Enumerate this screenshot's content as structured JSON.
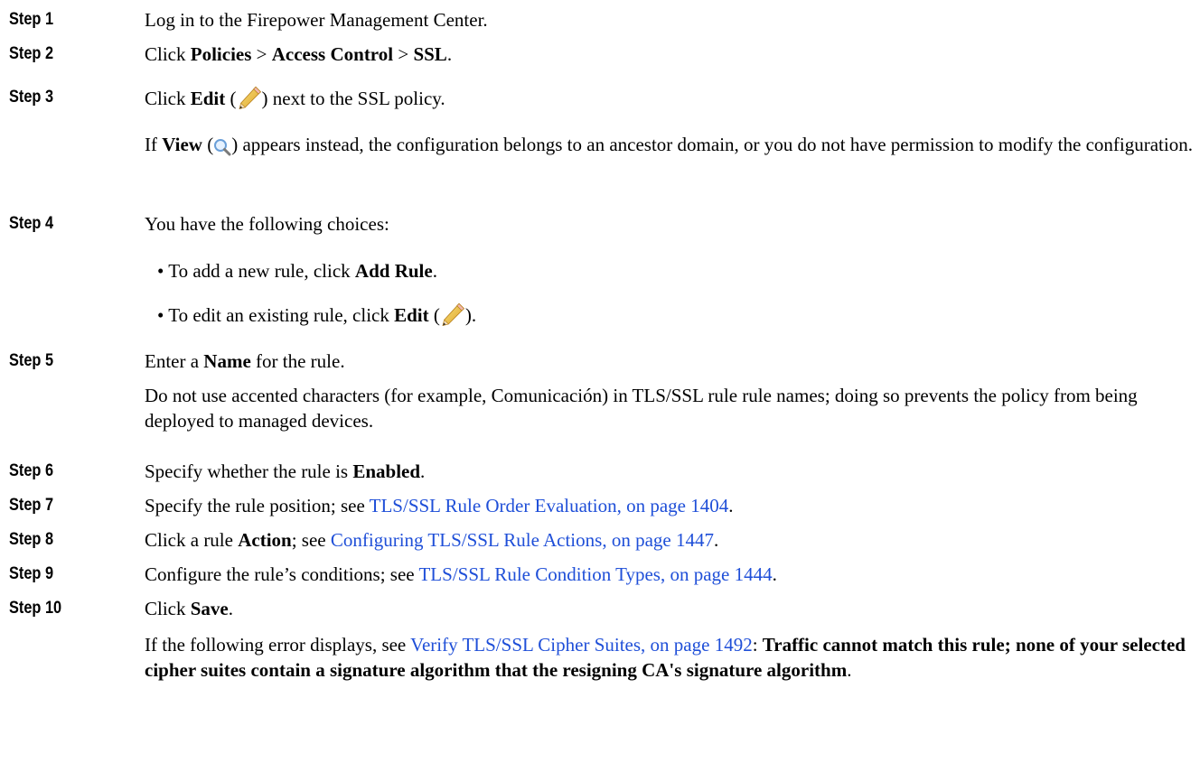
{
  "steps": {
    "s1": {
      "label": "Step 1",
      "text": "Log in to the Firepower Management Center."
    },
    "s2": {
      "label": "Step 2",
      "pre": "Click ",
      "b1": "Policies",
      "sep1": " > ",
      "b2": "Access Control",
      "sep2": " > ",
      "b3": "SSL",
      "post": "."
    },
    "s3": {
      "label": "Step 3",
      "pre": "Click ",
      "b1": "Edit",
      "open": " (",
      "close": ") next to the SSL policy.",
      "note_b": "View",
      "note_open": " (",
      "note_rest": ") appears instead, the configuration belongs to an ancestor domain, or you do not have permission to modify the configuration.",
      "note_if": "If "
    },
    "s4": {
      "label": "Step 4",
      "text": "You have the following choices:",
      "b1_pre": "• To add a new rule, click ",
      "b1_b": "Add Rule",
      "b1_post": ".",
      "b2_pre": "• To edit an existing rule, click ",
      "b2_b": "Edit",
      "b2_open": " (",
      "b2_close": ")."
    },
    "s5": {
      "label": "Step 5",
      "pre": "Enter a ",
      "b": "Name",
      "post": " for the rule.",
      "note": "Do not use accented characters (for example, Comunicación) in TLS/SSL rule rule names; doing so prevents the policy from being deployed to managed devices."
    },
    "s6": {
      "label": "Step 6",
      "pre": "Specify whether the rule is ",
      "b": "Enabled",
      "post": "."
    },
    "s7": {
      "label": "Step 7",
      "pre": "Specify the rule position; see ",
      "link": "TLS/SSL Rule Order Evaluation, on page 1404",
      "post": "."
    },
    "s8": {
      "label": "Step 8",
      "pre": "Click a rule ",
      "b": "Action",
      "mid": "; see ",
      "link": "Configuring TLS/SSL Rule Actions, on page 1447",
      "post": "."
    },
    "s9": {
      "label": "Step 9",
      "pre": "Configure the rule’s conditions; see ",
      "link": "TLS/SSL Rule Condition Types, on page 1444",
      "post": "."
    },
    "s10": {
      "label": "Step 10",
      "pre": "Click ",
      "b": "Save",
      "post": ".",
      "note_pre": "If the following error displays, see ",
      "note_link": "Verify TLS/SSL Cipher Suites, on page 1492",
      "note_colon": ": ",
      "note_b": "Traffic cannot match this rule; none of your selected cipher suites contain a signature algorithm that the resigning CA's signature algorithm",
      "note_post": "."
    }
  },
  "icons": {
    "edit": "pencil-icon",
    "view": "magnifier-icon"
  },
  "colors": {
    "link": "#1f4fd8"
  }
}
